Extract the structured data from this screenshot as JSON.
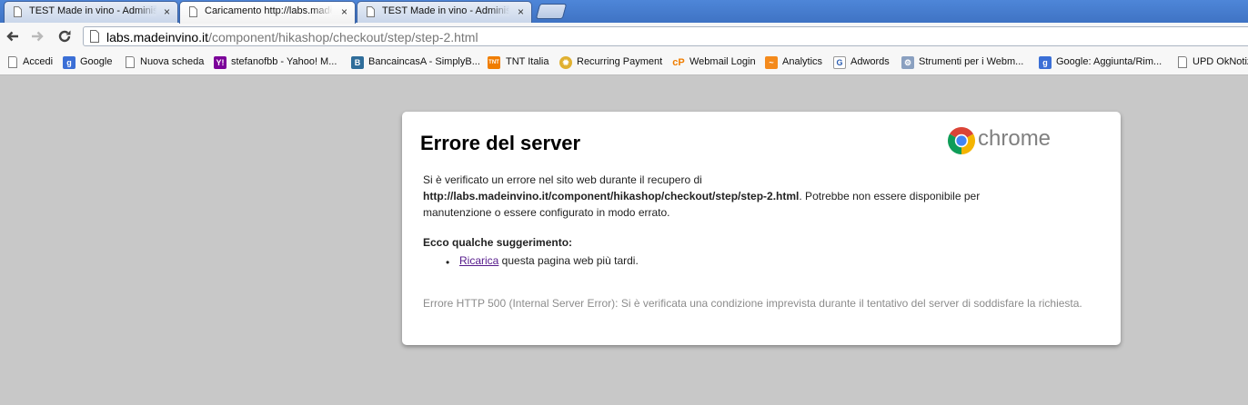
{
  "tabs": [
    {
      "title": "TEST Made in vino - Administ",
      "close": "×"
    },
    {
      "title": "Caricamento http://labs.made",
      "close": "×"
    },
    {
      "title": "TEST Made in vino - Administ",
      "close": "×"
    }
  ],
  "toolbar": {
    "url_host": "labs.madeinvino.it",
    "url_path": "/component/hikashop/checkout/step/step-2.html"
  },
  "bookmarks": [
    {
      "label": "Accedi",
      "icon": "document-icon"
    },
    {
      "label": "Google",
      "icon": "google-icon"
    },
    {
      "label": "Nuova scheda",
      "icon": "document-icon"
    },
    {
      "label": "stefanofbb - Yahoo! M...",
      "icon": "yahoo-icon"
    },
    {
      "label": "BancaincasA - SimplyB...",
      "icon": "bank-icon"
    },
    {
      "label": "TNT Italia",
      "icon": "tnt-icon"
    },
    {
      "label": "Recurring Payment",
      "icon": "gear-icon"
    },
    {
      "label": "Webmail Login",
      "icon": "cpanel-icon"
    },
    {
      "label": "Analytics",
      "icon": "analytics-icon"
    },
    {
      "label": "Adwords",
      "icon": "adwords-icon"
    },
    {
      "label": "Strumenti per i Webm...",
      "icon": "webmaster-icon"
    },
    {
      "label": "Google: Aggiunta/Rim...",
      "icon": "google-icon"
    },
    {
      "label": "UPD OkNotizie",
      "icon": "document-icon"
    }
  ],
  "error": {
    "title": "Errore del server",
    "brand": "chrome",
    "line1": "Si è verificato un errore nel sito web durante il recupero di",
    "failed_url": "http://labs.madeinvino.it/component/hikashop/checkout/step/step-2.html",
    "line2_suffix": ". Potrebbe non essere disponibile per",
    "line3": "manutenzione o essere configurato in modo errato.",
    "suggestions_heading": "Ecco qualche suggerimento:",
    "reload_link": "Ricarica",
    "reload_suffix": " questa pagina web più tardi.",
    "bullet": "•",
    "footer": "Errore HTTP 500 (Internal Server Error): Si è verificata una condizione imprevista durante il tentativo del server di soddisfare la richiesta."
  },
  "colors": {
    "tabstrip": "#4e86d8",
    "page_background": "#c8c8c8",
    "link_visited": "#551a8b"
  }
}
